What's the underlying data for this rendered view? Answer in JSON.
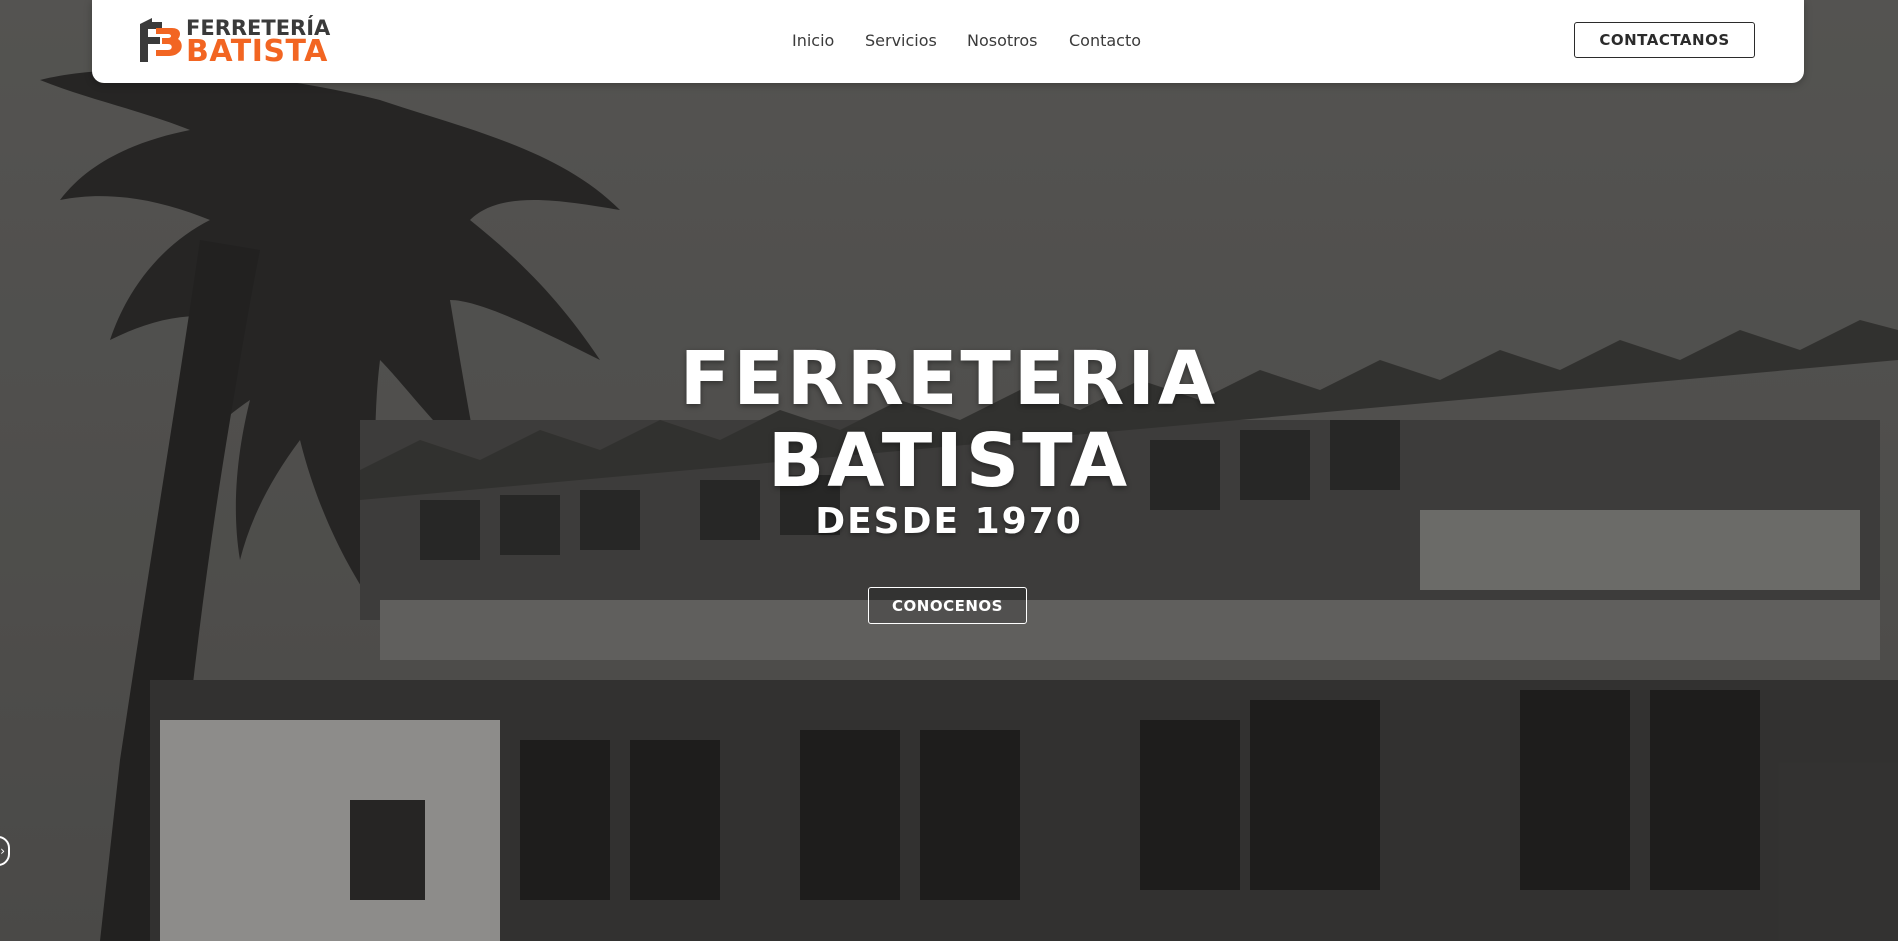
{
  "brand": {
    "top_text": "FERRETERÍA",
    "bottom_text": "BATISTA",
    "accent_color": "#f26522",
    "dark_color": "#3a3a3a"
  },
  "nav": {
    "links": [
      "Inicio",
      "Servicios",
      "Nosotros",
      "Contacto"
    ],
    "cta_label": "CONTACTANOS"
  },
  "hero": {
    "title_line1": "FERRETERIA",
    "title_line2": "BATISTA",
    "subtitle": "DESDE 1970",
    "button_label": "CONOCENOS",
    "background": "black-and-white historical photo of the store building"
  },
  "icons": {
    "side_tab": "chevron-right-icon"
  }
}
